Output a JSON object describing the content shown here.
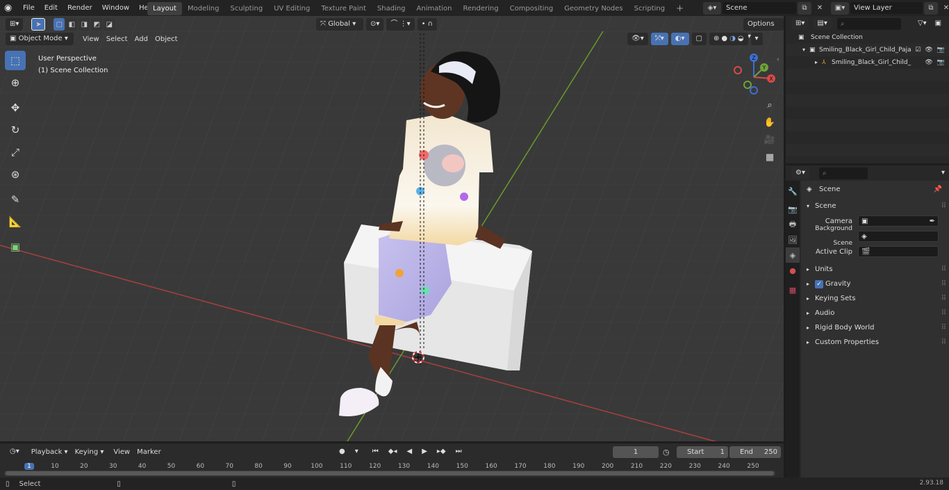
{
  "topbar": {
    "menus": [
      "File",
      "Edit",
      "Render",
      "Window",
      "Help"
    ],
    "workspaces": [
      "Layout",
      "Modeling",
      "Sculpting",
      "UV Editing",
      "Texture Paint",
      "Shading",
      "Animation",
      "Rendering",
      "Compositing",
      "Geometry Nodes",
      "Scripting"
    ],
    "active_workspace": "Layout",
    "scene_name": "Scene",
    "view_layer": "View Layer"
  },
  "viewport": {
    "mode": "Object Mode",
    "menus": [
      "View",
      "Select",
      "Add",
      "Object"
    ],
    "orientation": "Global",
    "options_label": "Options",
    "overlay_title": "User Perspective",
    "overlay_collection": "(1) Scene Collection",
    "gizmo": {
      "z": "Z",
      "y": "Y",
      "x": "X"
    }
  },
  "outliner": {
    "root": "Scene Collection",
    "items": [
      {
        "label": "Smiling_Black_Girl_Child_Paja",
        "depth": 1
      },
      {
        "label": "Smiling_Black_Girl_Child_",
        "depth": 2
      }
    ]
  },
  "properties": {
    "header": "Scene",
    "panel_title": "Scene",
    "fields": [
      {
        "label": "Camera"
      },
      {
        "label": "Background Scene"
      },
      {
        "label": "Active Clip"
      }
    ],
    "sections": [
      "Units",
      "Gravity",
      "Keying Sets",
      "Audio",
      "Rigid Body World",
      "Custom Properties"
    ],
    "gravity_checked": true
  },
  "timeline": {
    "menus": [
      "Playback",
      "Keying",
      "View",
      "Marker"
    ],
    "current_frame": "1",
    "start_label": "Start",
    "start_value": "1",
    "end_label": "End",
    "end_value": "250",
    "ruler": [
      "1",
      "10",
      "20",
      "30",
      "40",
      "50",
      "60",
      "70",
      "80",
      "90",
      "100",
      "110",
      "120",
      "130",
      "140",
      "150",
      "160",
      "170",
      "180",
      "190",
      "200",
      "210",
      "220",
      "230",
      "240",
      "250"
    ]
  },
  "statusbar": {
    "left": "Select",
    "version": "2.93.18"
  }
}
